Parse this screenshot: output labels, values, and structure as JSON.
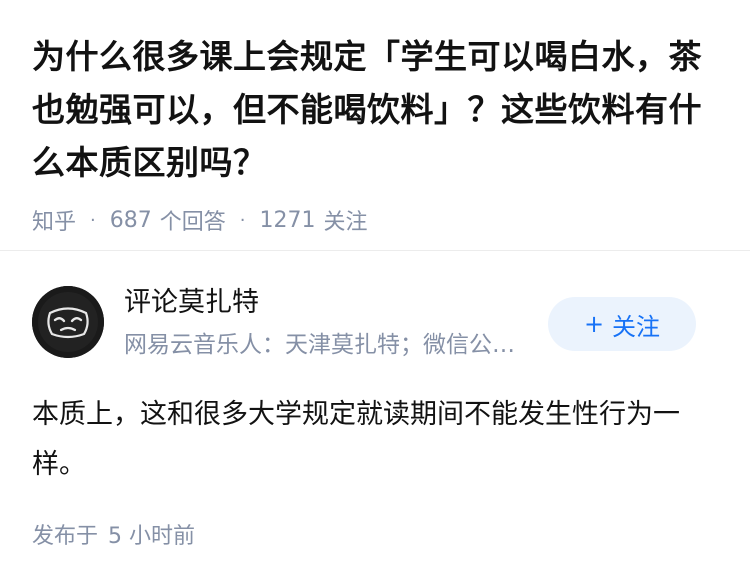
{
  "question": {
    "title": "为什么很多课上会规定「学生可以喝白水，茶也勉强可以，但不能喝饮料」？这些饮料有什么本质区别吗？",
    "source": "知乎",
    "answer_count": "687",
    "answer_count_label": "个回答",
    "follower_count": "1271",
    "follower_count_label": "关注",
    "separator": "·"
  },
  "author": {
    "name": "评论莫扎特",
    "headline": "网易云音乐人：天津莫扎特；微信公众号：评论莫扎特",
    "avatar_icon": "masked-face-icon",
    "follow_button": {
      "plus": "+",
      "label": "关注"
    }
  },
  "answer": {
    "content": "本质上，这和很多大学规定就读期间不能发生性行为一样。"
  },
  "footer": {
    "posted_prefix": "发布于",
    "posted_time": "5 小时前"
  },
  "colors": {
    "text": "#121212",
    "meta": "#8590a6",
    "accent": "#1772f6",
    "follow_bg": "#ebf3fd",
    "divider": "#ececec",
    "avatar_bg": "#1a1a1a"
  }
}
